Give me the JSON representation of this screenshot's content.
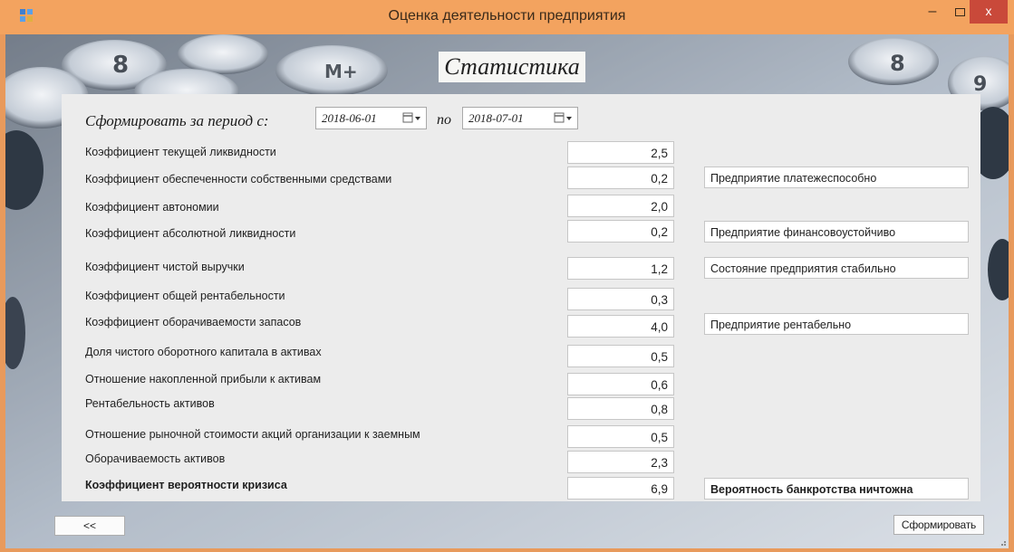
{
  "window": {
    "title": "Оценка деятельности предприятия",
    "minimize_glyph": "–",
    "close_glyph": "x"
  },
  "header": {
    "heading": "Статистика"
  },
  "period": {
    "from_label": "Сформировать за период с:",
    "from_date": "2018-06-01",
    "to_label": "по",
    "to_date": "2018-07-01"
  },
  "rows": [
    {
      "label": "Коэффициент текущей ликвидности",
      "value": "2,5"
    },
    {
      "label": "Коэффициент обеспеченности собственными средствами",
      "value": "0,2"
    },
    {
      "label": "Коэффициент автономии",
      "value": "2,0"
    },
    {
      "label": "Коэффициент абсолютной ликвидности",
      "value": "0,2"
    },
    {
      "label": "Коэффициент чистой выручки",
      "value": "1,2"
    },
    {
      "label": "Коэффициент общей рентабельности",
      "value": "0,3"
    },
    {
      "label": "Коэффициент оборачиваемости запасов",
      "value": "4,0"
    },
    {
      "label": "Доля чистого оборотного капитала в активах",
      "value": "0,5"
    },
    {
      "label": "Отношение накопленной прибыли к активам",
      "value": "0,6"
    },
    {
      "label": "Рентабельность активов",
      "value": "0,8"
    },
    {
      "label": "Отношение рыночной стоимости акций организации к заемным",
      "value": "0,5"
    },
    {
      "label": "Оборачиваемость активов",
      "value": "2,3"
    },
    {
      "label": "Коэффициент вероятности кризиса",
      "value": "6,9"
    }
  ],
  "statuses": [
    "Предприятие платежеспособно",
    "Предприятие финансовоустойчиво",
    "Состояние предприятия стабильно",
    "Предприятие рентабельно",
    "Вероятность банкротства ничтожна"
  ],
  "buttons": {
    "back": "<<",
    "submit": "Сформировать"
  },
  "colors": {
    "titlebar": "#f3a35f",
    "close": "#c9493a",
    "panel": "#ececec"
  }
}
